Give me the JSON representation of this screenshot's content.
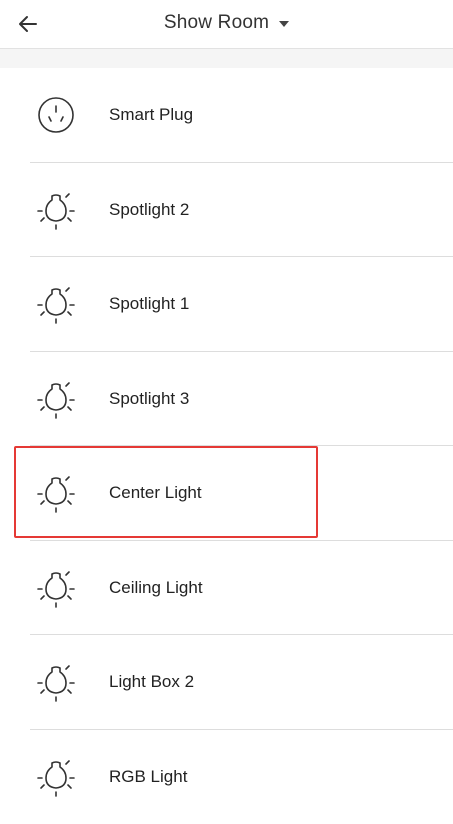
{
  "header": {
    "title": "Show Room",
    "back_icon": "back-arrow-icon",
    "dropdown_icon": "caret-down-icon"
  },
  "devices": [
    {
      "label": "Smart Plug",
      "icon": "smart-plug-icon"
    },
    {
      "label": "Spotlight 2",
      "icon": "bulb-icon"
    },
    {
      "label": "Spotlight 1",
      "icon": "bulb-icon"
    },
    {
      "label": "Spotlight 3",
      "icon": "bulb-icon"
    },
    {
      "label": "Center Light",
      "icon": "bulb-icon",
      "highlighted": true
    },
    {
      "label": "Ceiling Light",
      "icon": "bulb-icon"
    },
    {
      "label": "Light Box 2",
      "icon": "bulb-icon"
    },
    {
      "label": "RGB Light",
      "icon": "bulb-icon"
    }
  ],
  "colors": {
    "highlight": "#e53935",
    "divider": "#dddddd",
    "band": "#f5f5f5",
    "icon_stroke": "#333333"
  }
}
